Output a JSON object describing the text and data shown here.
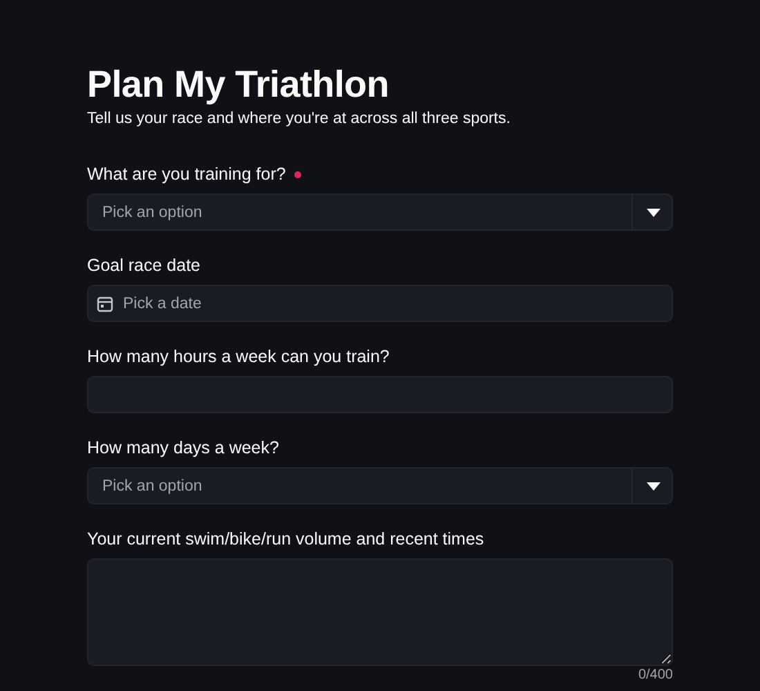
{
  "title": "Plan My Triathlon",
  "subtitle": "Tell us your race and where you're at across all three sports.",
  "fields": [
    {
      "kind": "select",
      "label": "What are you training for?",
      "required": true,
      "placeholder": "Pick an option"
    },
    {
      "kind": "date",
      "label": "Goal race date",
      "required": false,
      "placeholder": "Pick a date"
    },
    {
      "kind": "number",
      "label": "How many hours a week can you train?",
      "required": false
    },
    {
      "kind": "select",
      "label": "How many days a week?",
      "required": false,
      "placeholder": "Pick an option"
    },
    {
      "kind": "textarea",
      "label": "Your current swim/bike/run volume and recent times",
      "required": false,
      "counter": "0/400"
    }
  ]
}
